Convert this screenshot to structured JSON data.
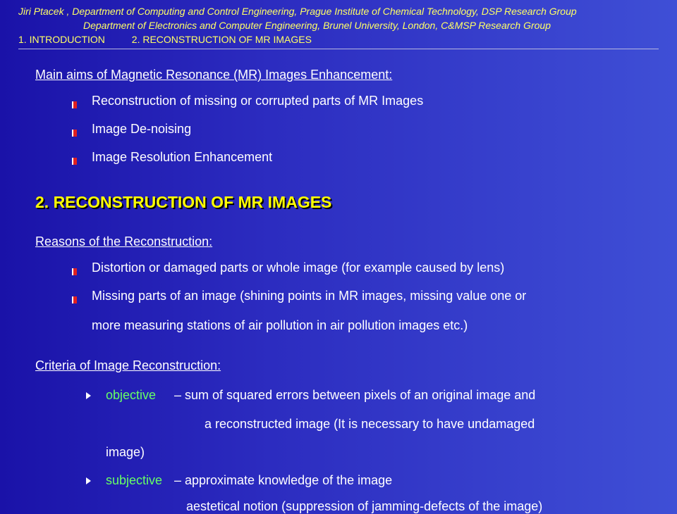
{
  "header": {
    "line1": "Jiri Ptacek ,  Department of Computing and Control Engineering, Prague Institute of Chemical Technology, DSP Research Group",
    "line2": "Department of Electronics and Computer Engineering, Brunel University, London, C&MSP Research Group",
    "nav": [
      "1. INTRODUCTION",
      "2. RECONSTRUCTION OF MR IMAGES"
    ]
  },
  "aims": {
    "title": "Main aims of Magnetic Resonance (MR) Images Enhancement:",
    "items": [
      "Reconstruction of missing or corrupted parts of MR Images",
      "Image De-noising",
      "Image Resolution Enhancement"
    ]
  },
  "section_heading": "2. RECONSTRUCTION OF MR IMAGES",
  "reasons": {
    "title": "Reasons of the Reconstruction:",
    "item1": "Distortion or damaged parts or whole image (for example caused by lens)",
    "item2_line1": "Missing parts of an image (shining points in MR images, missing value one or",
    "item2_line2": "more measuring stations of air pollution in air pollution images etc.)"
  },
  "criteria": {
    "title": "Criteria of Image Reconstruction:",
    "objective_term": "objective",
    "objective_line1": "– sum of squared errors between pixels of an original image and",
    "objective_line2": "a reconstructed image (It is necessary to have undamaged",
    "objective_line3": "image)",
    "subjective_term": "subjective",
    "subjective_line1": "– approximate knowledge of the image",
    "subjective_line2": "aestetical notion (suppression of jamming-defects of the image)"
  },
  "colors": {
    "header_text": "#ffff66",
    "heading": "#ffff00",
    "term": "#66ff66",
    "bullet": "#e22020"
  }
}
